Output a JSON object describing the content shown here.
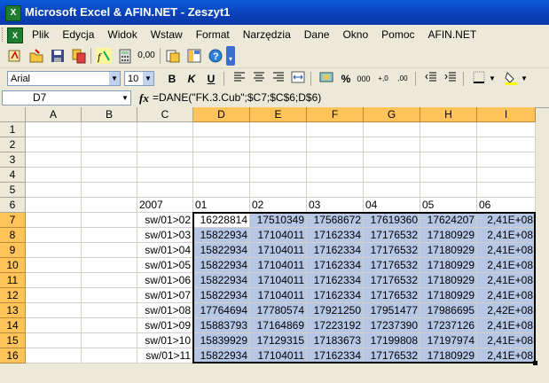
{
  "window": {
    "title": "Microsoft Excel & AFIN.NET - Zeszyt1"
  },
  "menu": [
    "Plik",
    "Edycja",
    "Widok",
    "Wstaw",
    "Format",
    "Narzędzia",
    "Dane",
    "Okno",
    "Pomoc",
    "AFIN.NET"
  ],
  "toolbar": {
    "buttons": [
      "fx-wizard-icon",
      "open-icon",
      "save-icon",
      "copy-icon",
      "formula-icon",
      "calculator-icon",
      "number-format-icon",
      "db-icon",
      "pivot-icon",
      "help-icon"
    ],
    "number_format_label": "0,00"
  },
  "format_toolbar": {
    "font_name": "Arial",
    "font_size": "10",
    "bold": "B",
    "italic": "K",
    "underline": "U",
    "percent": "%",
    "thousands": "000",
    "inc_decimal": "+,0",
    "dec_decimal": ",00"
  },
  "formula_bar": {
    "name_box": "D7",
    "fx": "fx",
    "formula": "=DANE(\"FK.3.Cub\";$C7;$C$6;D$6)"
  },
  "sheet": {
    "columns": [
      "A",
      "B",
      "C",
      "D",
      "E",
      "F",
      "G",
      "H",
      "I"
    ],
    "rows": [
      "1",
      "2",
      "3",
      "4",
      "5",
      "6",
      "7",
      "8",
      "9",
      "10",
      "11",
      "12",
      "13",
      "14",
      "15",
      "16"
    ],
    "header_row": {
      "row": "6",
      "C": "2007",
      "D": "01",
      "E": "02",
      "F": "03",
      "G": "04",
      "H": "05",
      "I": "06"
    },
    "data_rows": [
      {
        "row": "7",
        "label": "sw/01>02",
        "values": [
          "16228814",
          "17510349",
          "17568672",
          "17619360",
          "17624207",
          "2,41E+08"
        ]
      },
      {
        "row": "8",
        "label": "sw/01>03",
        "values": [
          "15822934",
          "17104011",
          "17162334",
          "17176532",
          "17180929",
          "2,41E+08"
        ]
      },
      {
        "row": "9",
        "label": "sw/01>04",
        "values": [
          "15822934",
          "17104011",
          "17162334",
          "17176532",
          "17180929",
          "2,41E+08"
        ]
      },
      {
        "row": "10",
        "label": "sw/01>05",
        "values": [
          "15822934",
          "17104011",
          "17162334",
          "17176532",
          "17180929",
          "2,41E+08"
        ]
      },
      {
        "row": "11",
        "label": "sw/01>06",
        "values": [
          "15822934",
          "17104011",
          "17162334",
          "17176532",
          "17180929",
          "2,41E+08"
        ]
      },
      {
        "row": "12",
        "label": "sw/01>07",
        "values": [
          "15822934",
          "17104011",
          "17162334",
          "17176532",
          "17180929",
          "2,41E+08"
        ]
      },
      {
        "row": "13",
        "label": "sw/01>08",
        "values": [
          "17764694",
          "17780574",
          "17921250",
          "17951477",
          "17986695",
          "2,42E+08"
        ]
      },
      {
        "row": "14",
        "label": "sw/01>09",
        "values": [
          "15883793",
          "17164869",
          "17223192",
          "17237390",
          "17237126",
          "2,41E+08"
        ]
      },
      {
        "row": "15",
        "label": "sw/01>10",
        "values": [
          "15839929",
          "17129315",
          "17183673",
          "17199808",
          "17197974",
          "2,41E+08"
        ]
      },
      {
        "row": "16",
        "label": "sw/01>11",
        "values": [
          "15822934",
          "17104011",
          "17162334",
          "17176532",
          "17180929",
          "2,41E+08"
        ]
      }
    ]
  }
}
